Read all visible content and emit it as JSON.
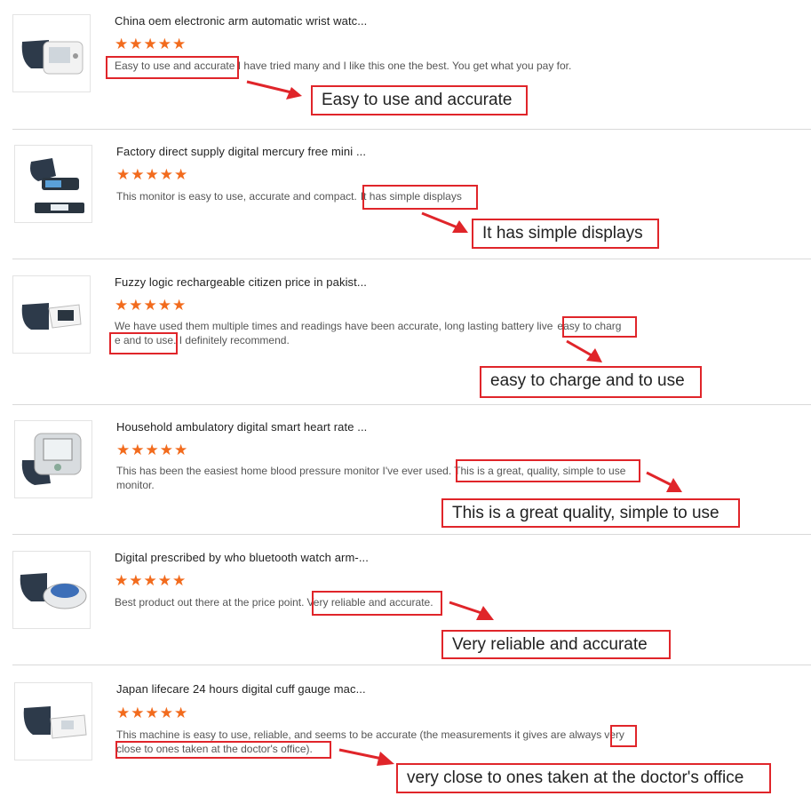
{
  "reviews": [
    {
      "title": "China oem electronic arm automatic wrist watc...",
      "stars": "★★★★★",
      "line1_a": "Easy to use and accurate",
      "line1_b": " I have tried many and I like this one the best. You get what you pay for.",
      "callout": "Easy to use and accurate"
    },
    {
      "title": "Factory direct supply digital mercury free mini ...",
      "stars": "★★★★★",
      "line1_a": "This monitor is easy to use, accurate and compact.",
      "line1_b": "It has simple displays",
      "callout": "It has simple displays"
    },
    {
      "title": "Fuzzy logic rechargeable citizen price in pakist...",
      "stars": "★★★★★",
      "line1_a": "We have used them multiple times and readings have been accurate, long lasting battery live",
      "line1_b": "easy to charg",
      "line2_a": "e and to use",
      "line2_b": ". I definitely recommend.",
      "callout": "easy to charge and to use"
    },
    {
      "title": "Household ambulatory digital smart heart rate ...",
      "stars": "★★★★★",
      "line1_a": "This has been the easiest home blood pressure monitor I've ever used.",
      "line1_b": "This is a great, quality, simple to use",
      "line2_a": "monitor.",
      "callout": "This is a great quality, simple to use"
    },
    {
      "title": "Digital prescribed by who bluetooth watch arm-...",
      "stars": "★★★★★",
      "line1_a": "Best product out there at the price point.",
      "line1_b": "Very reliable and accurate.",
      "callout": "Very reliable and accurate"
    },
    {
      "title": "Japan lifecare 24 hours digital cuff gauge mac...",
      "stars": "★★★★★",
      "line1_a": "This machine is easy to use, reliable, and seems to be accurate (the measurements it gives are always",
      "line1_b": "very",
      "line2_a": "close to ones taken at the doctor's office).",
      "callout": "very close to ones taken at the doctor's office"
    }
  ],
  "colors": {
    "highlight": "#e0252a",
    "star": "#f26b1d",
    "divider": "#d9d9d9"
  },
  "icons": {
    "product_image": "blood-pressure-monitor-image",
    "arrow": "red-arrow-icon"
  }
}
